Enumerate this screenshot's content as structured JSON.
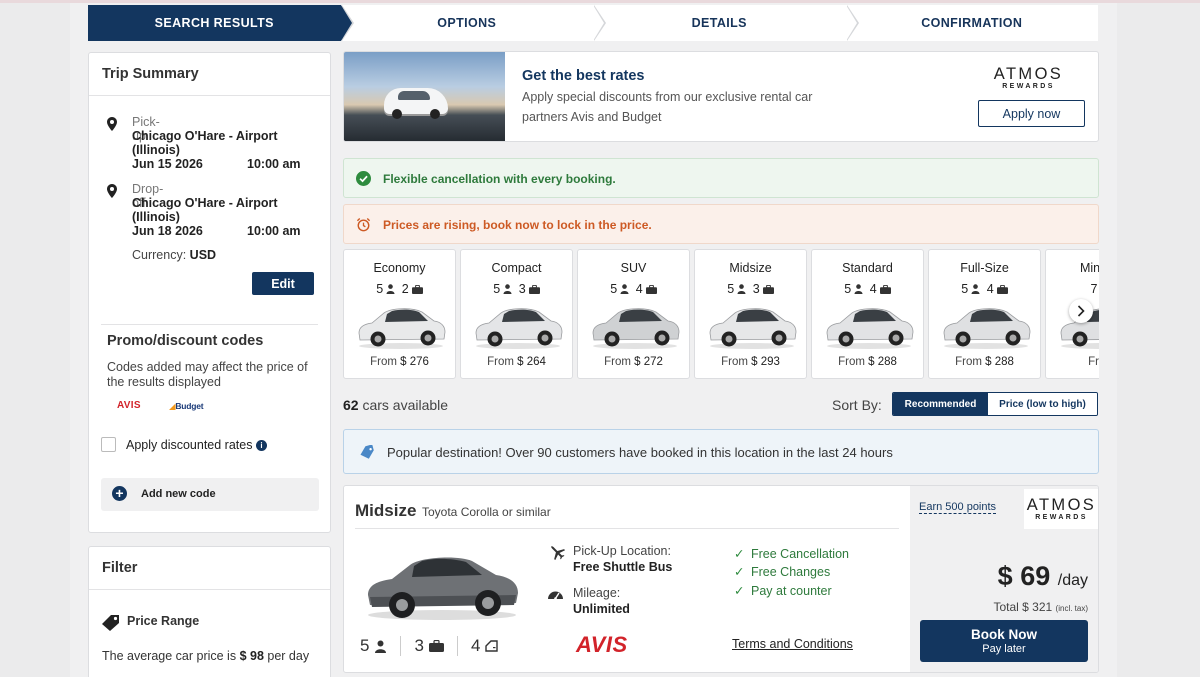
{
  "steps": [
    {
      "label": "SEARCH RESULTS",
      "active": true
    },
    {
      "label": "OPTIONS",
      "active": false
    },
    {
      "label": "DETAILS",
      "active": false
    },
    {
      "label": "CONFIRMATION",
      "active": false
    }
  ],
  "trip_summary": {
    "title": "Trip Summary",
    "pickup": {
      "label": "Pick-up",
      "location": "Chicago O'Hare - Airport (Illinois)",
      "date": "Jun 15 2026",
      "time": "10:00 am"
    },
    "dropoff": {
      "label": "Drop-off",
      "location": "Chicago O'Hare - Airport (Illinois)",
      "date": "Jun 18 2026",
      "time": "10:00 am"
    },
    "currency_label": "Currency:",
    "currency": "USD",
    "edit_label": "Edit"
  },
  "promo": {
    "title": "Promo/discount codes",
    "description": "Codes added may affect the price of the results displayed",
    "logo_avis": "AVIS",
    "logo_budget": "Budget",
    "apply_discounted_label": "Apply discounted rates",
    "add_code_label": "Add new code"
  },
  "filter": {
    "title": "Filter",
    "price_range_label": "Price Range",
    "avg_text_pre": "The average car price is ",
    "avg_price": "$ 98",
    "avg_text_post": " per day"
  },
  "banner": {
    "title": "Get the best rates",
    "description": "Apply special discounts from our exclusive rental car partners Avis and Budget",
    "brand_main": "ATMOS",
    "brand_sub": "REWARDS",
    "apply_label": "Apply now"
  },
  "alerts": {
    "flexible": "Flexible cancellation with every booking.",
    "rising": "Prices are rising, book now to lock in the price."
  },
  "car_classes": [
    {
      "name": "Economy",
      "passengers": "5",
      "bags": "2",
      "price": "$ 276",
      "color": "#e8e9ea"
    },
    {
      "name": "Compact",
      "passengers": "5",
      "bags": "3",
      "price": "$ 264",
      "color": "#e4e5e7"
    },
    {
      "name": "SUV",
      "passengers": "5",
      "bags": "4",
      "price": "$ 272",
      "color": "#cfd1d3"
    },
    {
      "name": "Midsize",
      "passengers": "5",
      "bags": "3",
      "price": "$ 293",
      "color": "#e6e7e8"
    },
    {
      "name": "Standard",
      "passengers": "5",
      "bags": "4",
      "price": "$ 288",
      "color": "#e2e3e5"
    },
    {
      "name": "Full-Size",
      "passengers": "5",
      "bags": "4",
      "price": "$ 288",
      "color": "#dfe0e2"
    },
    {
      "name": "Minivan",
      "passengers": "7",
      "bags": "",
      "price": "",
      "color": "#dfe0e2"
    }
  ],
  "from_label": "From",
  "results": {
    "count": "62",
    "count_label": " cars available",
    "sort_label": "Sort By:",
    "sort_options": [
      "Recommended",
      "Price (low to high)"
    ]
  },
  "popular": "Popular destination! Over 90 customers have booked in this location in the last 24 hours",
  "result_card": {
    "category": "Midsize",
    "model": "Toyota Corolla or similar",
    "passengers": "5",
    "bags": "3",
    "doors": "4",
    "pickup_label": "Pick-Up Location:",
    "pickup_value": "Free Shuttle Bus",
    "mileage_label": "Mileage:",
    "mileage_value": "Unlimited",
    "vendor": "AVIS",
    "features": [
      "Free Cancellation",
      "Free Changes",
      "Pay at counter"
    ],
    "terms_label": "Terms and Conditions",
    "earn_label": "Earn 500 points",
    "brand_main": "ATMOS",
    "brand_sub": "REWARDS",
    "price": "$ 69",
    "price_unit": "/day",
    "total_label": "Total $ 321",
    "total_note": "(incl. tax)",
    "book_label": "Book Now",
    "book_sub": "Pay later"
  },
  "colors": {
    "primary": "#13365f",
    "success": "#2e7a3c",
    "warning": "#cd5a24",
    "avis_red": "#d2232a"
  }
}
